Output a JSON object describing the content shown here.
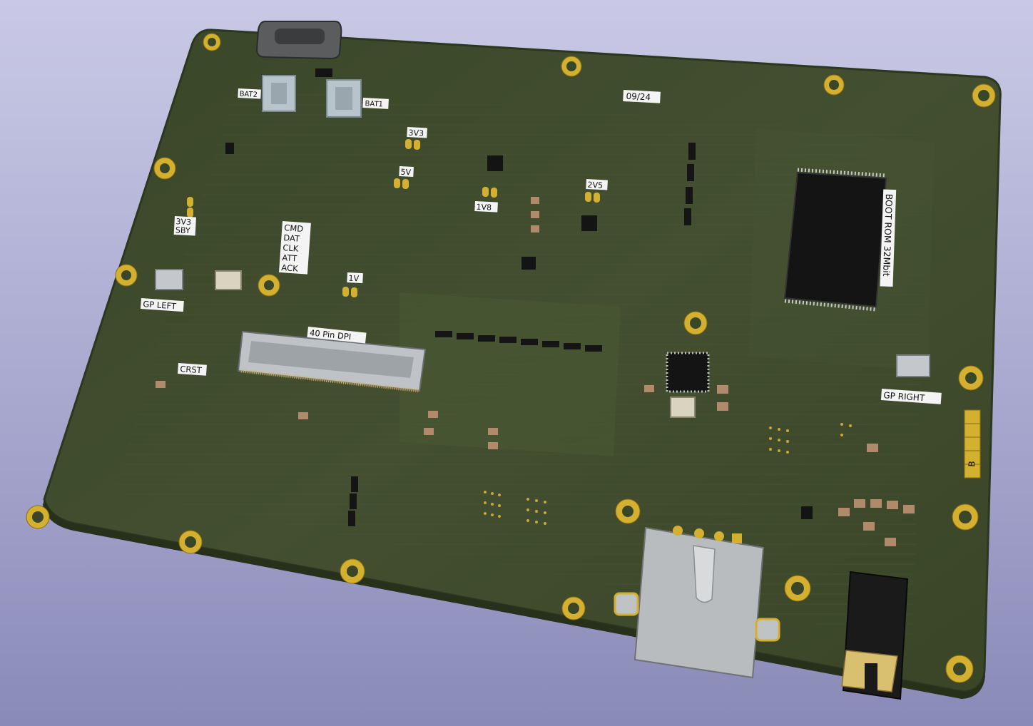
{
  "board": {
    "colors": {
      "background_top": "#c9c9e6",
      "background_bottom": "#8a8ab8",
      "pcb": "#3e4a2c",
      "pcb_edge": "#2e3a20",
      "pad_gold": "#d4b030",
      "silkscreen": "#f4f4f4"
    },
    "labels": {
      "date": "09/24",
      "bat1": "BAT1",
      "bat2": "BAT2",
      "rail_3v3": "3V3",
      "rail_5v": "5V",
      "rail_1v8": "1V8",
      "rail_2v5": "2V5",
      "rail_1v": "1V",
      "rail_3v3_line1": "3V3",
      "rail_3v3_line2": "SBY",
      "sig_cmd": "CMD",
      "sig_dat": "DAT",
      "sig_clk": "CLK",
      "sig_att": "ATT",
      "sig_ack": "ACK",
      "gp_left": "GP LEFT",
      "gp_right": "GP RIGHT",
      "crst": "CRST",
      "dpi": "40 Pin DPI",
      "boot_rom": "BOOT ROM 32Mbit",
      "side_letter": "B"
    }
  }
}
